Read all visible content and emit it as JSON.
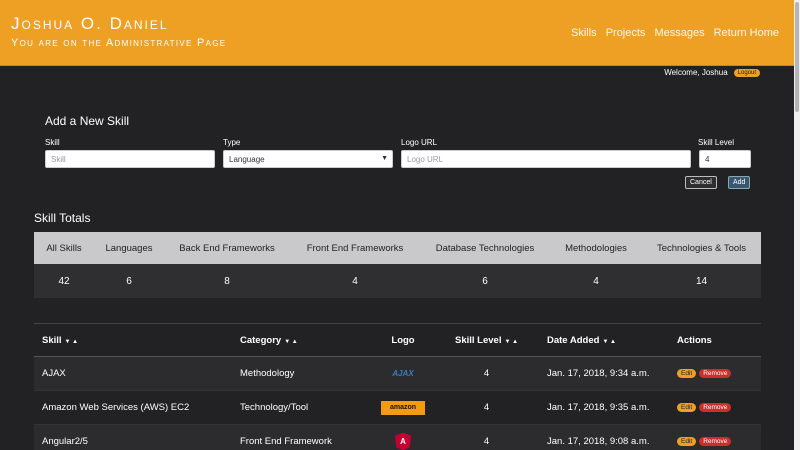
{
  "header": {
    "name": "Joshua O. Daniel",
    "subtitle": "You are on the Administrative Page",
    "nav": [
      "Skills",
      "Projects",
      "Messages",
      "Return Home"
    ]
  },
  "welcome": {
    "text": "Welcome, Joshua",
    "logout": "Logout"
  },
  "add_skill": {
    "title": "Add a New Skill",
    "skill_label": "Skill",
    "skill_placeholder": "Skill",
    "type_label": "Type",
    "type_value": "Language",
    "logo_label": "Logo URL",
    "logo_placeholder": "Logo URL",
    "level_label": "Skill Level",
    "level_value": "4",
    "cancel": "Cancel",
    "add": "Add"
  },
  "totals": {
    "title": "Skill Totals",
    "headers": [
      "All Skills",
      "Languages",
      "Back End Frameworks",
      "Front End Frameworks",
      "Database Technologies",
      "Methodologies",
      "Technologies & Tools"
    ],
    "values": [
      "42",
      "6",
      "8",
      "4",
      "6",
      "4",
      "14"
    ]
  },
  "skills_table": {
    "headers": {
      "skill": "Skill",
      "category": "Category",
      "logo": "Logo",
      "level": "Skill Level",
      "date": "Date Added",
      "actions": "Actions"
    },
    "edit": "Edit",
    "remove": "Remove",
    "rows": [
      {
        "skill": "AJAX",
        "category": "Methodology",
        "logo": "AJAX",
        "level": "4",
        "date": "Jan. 17, 2018, 9:34 a.m."
      },
      {
        "skill": "Amazon Web Services (AWS) EC2",
        "category": "Technology/Tool",
        "logo": "amazon",
        "level": "4",
        "date": "Jan. 17, 2018, 9:35 a.m."
      },
      {
        "skill": "Angular2/5",
        "category": "Front End Framework",
        "logo": "A",
        "level": "4",
        "date": "Jan. 17, 2018, 9:08 a.m."
      }
    ]
  },
  "colors": {
    "accent": "#eea024",
    "background": "#222224",
    "remove": "#c9302c"
  }
}
